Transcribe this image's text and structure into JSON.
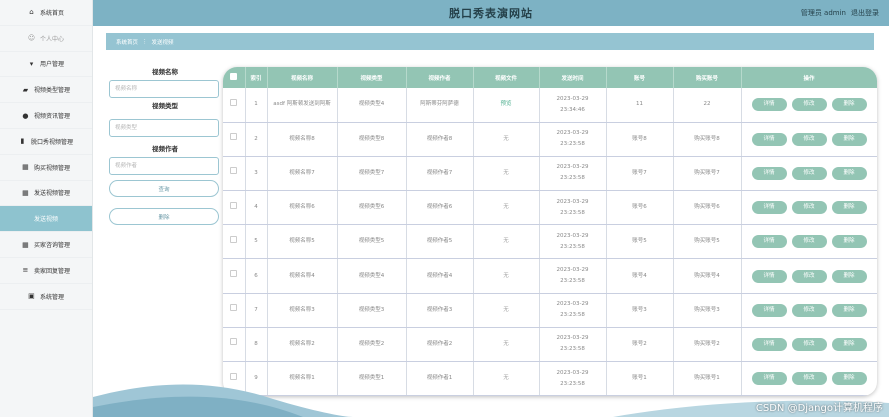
{
  "header": {
    "title": "脱口秀表演网站",
    "user_label": "管理员 admin",
    "logout_label": "退出登录"
  },
  "sidebar": {
    "items": [
      {
        "label": "系统首页",
        "icon": "home-icon"
      },
      {
        "label": "个人中心",
        "icon": "person-icon"
      },
      {
        "label": "用户管理",
        "icon": "pin-icon"
      },
      {
        "label": "视频类型管理",
        "icon": "folder-icon"
      },
      {
        "label": "视频资讯管理",
        "icon": "person-icon"
      },
      {
        "label": "脱口秀视频管理",
        "icon": "doc-icon"
      },
      {
        "label": "购买视频管理",
        "icon": "grid-icon"
      },
      {
        "label": "发送视频管理",
        "icon": "grid-icon"
      },
      {
        "label": "发送视频",
        "icon": ""
      },
      {
        "label": "买家咨询管理",
        "icon": "grid-icon"
      },
      {
        "label": "卖家回复管理",
        "icon": "list-icon"
      },
      {
        "label": "系统管理",
        "icon": "clipboard-icon"
      }
    ]
  },
  "breadcrumb": {
    "home": "系统首页",
    "sep": "⋮",
    "current": "发送视频"
  },
  "search": {
    "name_label": "视频名称",
    "name_placeholder": "视频名称",
    "type_label": "视频类型",
    "type_placeholder": "视频类型",
    "author_label": "视频作者",
    "author_placeholder": "视频作者",
    "query_button": "查询",
    "delete_button": "删除"
  },
  "table": {
    "headers": [
      "索引",
      "视频名称",
      "视频类型",
      "视频作者",
      "视频文件",
      "发送时间",
      "账号",
      "购买账号",
      "操作"
    ],
    "ops": {
      "detail": "详情",
      "edit": "修改",
      "delete": "删除"
    },
    "rows": [
      {
        "index": "1",
        "name": "asdf 阿斯顿发送到阿斯",
        "type": "视频类型4",
        "author": "阿斯蒂芬阿萨德",
        "file": "预览",
        "time": "2023-03-29 23:34:46",
        "account": "11",
        "buyer": "22"
      },
      {
        "index": "2",
        "name": "视频名称8",
        "type": "视频类型8",
        "author": "视频作者8",
        "file": "无",
        "time": "2023-03-29 23:23:58",
        "account": "账号8",
        "buyer": "购买账号8"
      },
      {
        "index": "3",
        "name": "视频名称7",
        "type": "视频类型7",
        "author": "视频作者7",
        "file": "无",
        "time": "2023-03-29 23:23:58",
        "account": "账号7",
        "buyer": "购买账号7"
      },
      {
        "index": "4",
        "name": "视频名称6",
        "type": "视频类型6",
        "author": "视频作者6",
        "file": "无",
        "time": "2023-03-29 23:23:58",
        "account": "账号6",
        "buyer": "购买账号6"
      },
      {
        "index": "5",
        "name": "视频名称5",
        "type": "视频类型5",
        "author": "视频作者5",
        "file": "无",
        "time": "2023-03-29 23:23:58",
        "account": "账号5",
        "buyer": "购买账号5"
      },
      {
        "index": "6",
        "name": "视频名称4",
        "type": "视频类型4",
        "author": "视频作者4",
        "file": "无",
        "time": "2023-03-29 23:23:58",
        "account": "账号4",
        "buyer": "购买账号4"
      },
      {
        "index": "7",
        "name": "视频名称3",
        "type": "视频类型3",
        "author": "视频作者3",
        "file": "无",
        "time": "2023-03-29 23:23:58",
        "account": "账号3",
        "buyer": "购买账号3"
      },
      {
        "index": "8",
        "name": "视频名称2",
        "type": "视频类型2",
        "author": "视频作者2",
        "file": "无",
        "time": "2023-03-29 23:23:58",
        "account": "账号2",
        "buyer": "购买账号2"
      },
      {
        "index": "9",
        "name": "视频名称1",
        "type": "视频类型1",
        "author": "视频作者1",
        "file": "无",
        "time": "2023-03-29 23:23:58",
        "account": "账号1",
        "buyer": "购买账号1"
      }
    ]
  },
  "watermark": "CSDN @Django计算机程序",
  "colors": {
    "accent": "#93c5b4",
    "topbar": "#7db2c4",
    "breadcrumb": "#95c4d2",
    "sidebar_active": "#8ec3cf"
  }
}
